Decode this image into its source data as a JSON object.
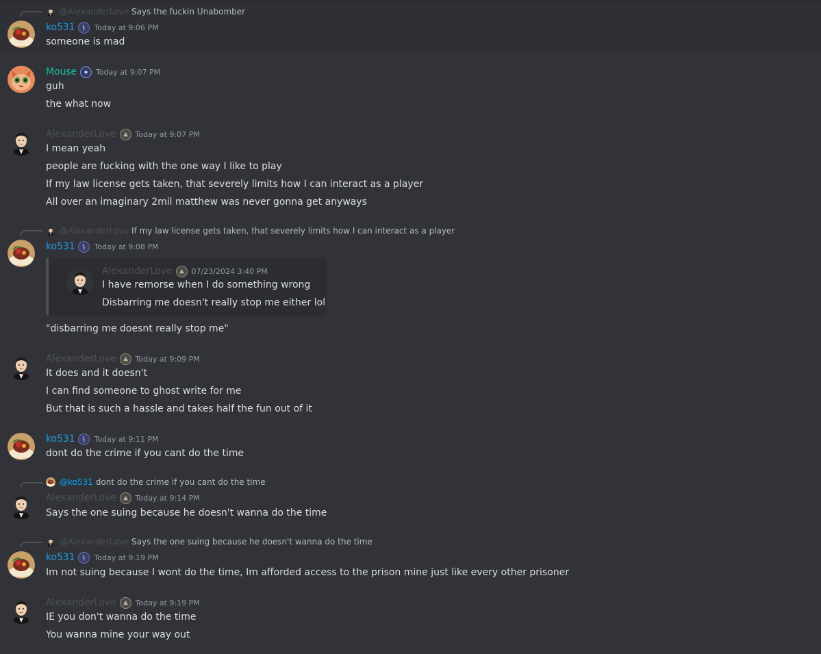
{
  "users": {
    "ko": {
      "name": "ko531",
      "color": "#1f9bde",
      "avatar": "sundae-avatar",
      "badge": "clan-badge-icon"
    },
    "mouse": {
      "name": "Mouse",
      "color": "#1abc9c",
      "avatar": "cat-avatar",
      "badge": "gem-badge-icon"
    },
    "alex": {
      "name": "AlexanderLove",
      "color": "#4e5058",
      "avatar": "suit-man-avatar",
      "badge": "triangle-badge-icon"
    }
  },
  "messages": [
    {
      "author": "ko531",
      "time": "Today at 9:06 PM",
      "reply": {
        "mention": "@AlexanderLove",
        "text": "Says the fuckin Unabomber"
      },
      "lines": [
        "someone is mad"
      ]
    },
    {
      "author": "Mouse",
      "time": "Today at 9:07 PM",
      "lines": [
        "guh",
        "the what now"
      ]
    },
    {
      "author": "AlexanderLove",
      "time": "Today at 9:07 PM",
      "lines": [
        "I mean yeah",
        "people are fucking with the one way I like to play",
        "If my law license gets taken, that severely limits how I can interact as a player",
        "All over an imaginary 2mil matthew was never gonna get anyways"
      ]
    },
    {
      "author": "ko531",
      "time": "Today at 9:08 PM",
      "reply": {
        "mention": "@AlexanderLove",
        "text": "If my law license gets taken, that severely limits how I can interact as a player"
      },
      "embed": {
        "author": "AlexanderLove",
        "time": "07/23/2024 3:40 PM",
        "lines": [
          "I have remorse when I do something wrong",
          "Disbarring me doesn't really stop me either lol"
        ]
      },
      "lines": [
        "\"disbarring me doesnt really stop me\""
      ]
    },
    {
      "author": "AlexanderLove",
      "time": "Today at 9:09 PM",
      "lines": [
        "It does and it doesn't",
        "I can find someone to ghost write for me",
        "But that is such a hassle and takes half the fun out of it"
      ]
    },
    {
      "author": "ko531",
      "time": "Today at 9:11 PM",
      "lines": [
        "dont do the crime if you cant do the time"
      ]
    },
    {
      "author": "AlexanderLove",
      "time": "Today at 9:14 PM",
      "reply": {
        "mention": "@ko531",
        "text": "dont do the crime if you cant do the time"
      },
      "lines": [
        "Says the one suing because he doesn't wanna do the time"
      ]
    },
    {
      "author": "ko531",
      "time": "Today at 9:19 PM",
      "reply": {
        "mention": "@AlexanderLove",
        "text": "Says the one suing because he doesn't wanna do the time"
      },
      "lines": [
        "Im not suing because I wont do the time, Im afforded access to the prison mine just like every other prisoner"
      ]
    },
    {
      "author": "AlexanderLove",
      "time": "Today at 9:19 PM",
      "lines": [
        "IE you don't wanna do the time",
        "You wanna mine your way out"
      ]
    }
  ]
}
